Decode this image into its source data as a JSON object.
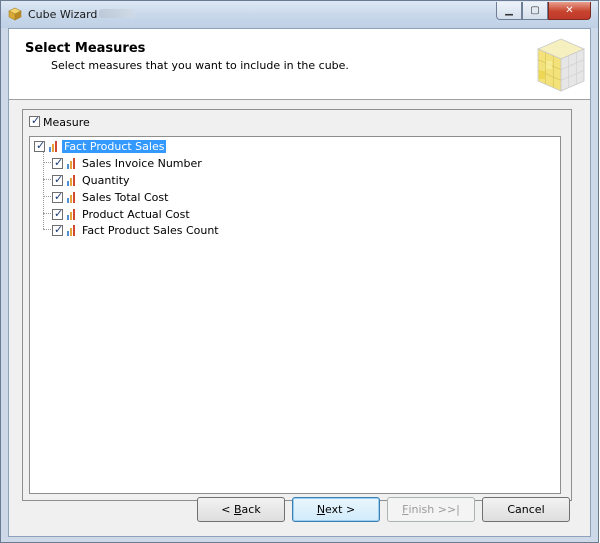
{
  "window": {
    "title": "Cube Wizard",
    "controls": {
      "minimize": "▁",
      "maximize": "▢",
      "close": "✕"
    }
  },
  "header": {
    "title": "Select Measures",
    "subtitle": "Select measures that you want to include in the cube."
  },
  "measure_panel": {
    "header_label": "Measure",
    "header_checked": true,
    "tree": {
      "root": {
        "label": "Fact Product Sales",
        "checked": true,
        "selected": true
      },
      "children": [
        {
          "label": "Sales Invoice Number",
          "checked": true
        },
        {
          "label": "Quantity",
          "checked": true
        },
        {
          "label": "Sales Total Cost",
          "checked": true
        },
        {
          "label": "Product Actual Cost",
          "checked": true
        },
        {
          "label": "Fact Product Sales Count",
          "checked": true
        }
      ]
    }
  },
  "buttons": {
    "back": {
      "prefix": "< ",
      "accel": "B",
      "rest": "ack"
    },
    "next": {
      "accel": "N",
      "rest": "ext >"
    },
    "finish": {
      "accel": "F",
      "rest": "inish >>|"
    },
    "cancel": {
      "label": "Cancel"
    }
  },
  "colors": {
    "selection": "#3399ff",
    "title_gradient_top": "#dfe9f5",
    "close_button": "#c7432d",
    "default_button_border": "#3c7fb1"
  }
}
